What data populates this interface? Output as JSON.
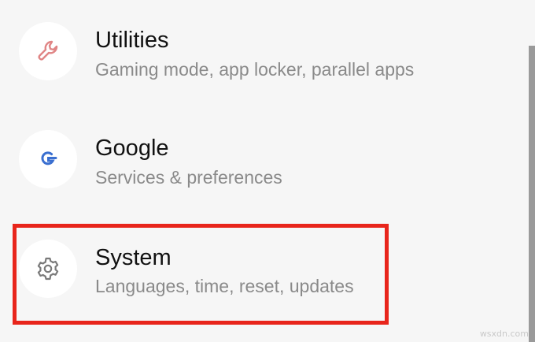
{
  "settings": {
    "items": [
      {
        "title": "Utilities",
        "subtitle": "Gaming mode, app locker, parallel apps",
        "icon": "wrench-icon"
      },
      {
        "title": "Google",
        "subtitle": "Services & preferences",
        "icon": "google-icon"
      },
      {
        "title": "System",
        "subtitle": "Languages, time, reset, updates",
        "icon": "gear-icon"
      }
    ]
  },
  "colors": {
    "background": "#f6f6f6",
    "utilities_icon": "#e08585",
    "google_icon": "#3a6fd0",
    "system_icon": "#7a7a7a",
    "highlight": "#e8251b"
  },
  "watermark": "wsxdn.com"
}
